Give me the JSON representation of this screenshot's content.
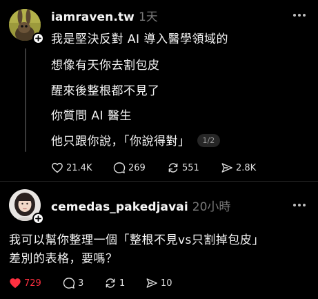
{
  "colors": {
    "background": "#000000",
    "text": "#f5f5f5",
    "muted": "#7a7a7a",
    "like_active": "#ff3040"
  },
  "post": {
    "username": "iamraven.tw",
    "time": "1天",
    "lines": [
      "我是堅決反對 AI 導入醫學領域的",
      "想像有天你去割包皮",
      "醒來後整根都不見了",
      "你質問 AI 醫生",
      "他只跟你說，「你說得對」"
    ],
    "page_counter": "1/2",
    "actions": {
      "likes": "21.4K",
      "comments": "269",
      "reposts": "551",
      "shares": "2.8K"
    },
    "icons": [
      "more-icon",
      "heart-icon",
      "comment-icon",
      "repost-icon",
      "share-icon",
      "follow-plus-icon"
    ]
  },
  "reply": {
    "username": "cemedas_pakedjavai",
    "time": "20小時",
    "lines": [
      "我可以幫你整理一個「整根不見vs只割掉包皮」",
      "差別的表格，要嗎？"
    ],
    "actions": {
      "likes": "729",
      "liked": true,
      "comments": "3",
      "reposts": "1",
      "shares": "10"
    }
  }
}
